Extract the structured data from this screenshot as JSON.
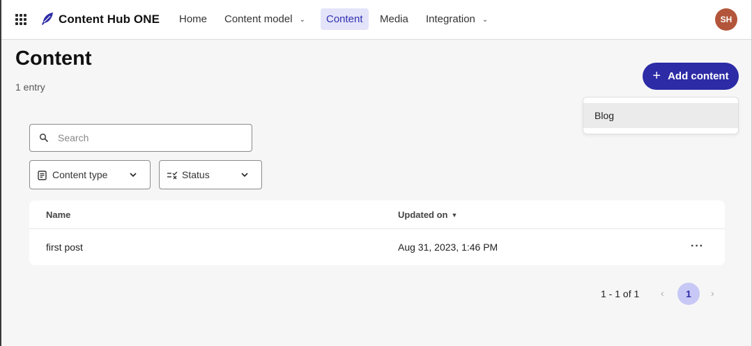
{
  "header": {
    "brand": "Content Hub ONE",
    "nav": [
      {
        "label": "Home",
        "has_dropdown": false,
        "active": false
      },
      {
        "label": "Content model",
        "has_dropdown": true,
        "active": false
      },
      {
        "label": "Content",
        "has_dropdown": false,
        "active": true
      },
      {
        "label": "Media",
        "has_dropdown": false,
        "active": false
      },
      {
        "label": "Integration",
        "has_dropdown": true,
        "active": false
      }
    ],
    "avatar_initials": "SH",
    "icons": [
      "apps-grid-icon",
      "feather-logo-icon"
    ]
  },
  "page": {
    "title": "Content",
    "entry_count": "1 entry"
  },
  "add_content": {
    "label": "Add content",
    "menu_items": [
      "Blog"
    ]
  },
  "search": {
    "placeholder": "Search",
    "value": ""
  },
  "filters": {
    "content_type": "Content type",
    "status": "Status"
  },
  "table": {
    "columns": [
      "Name",
      "Updated on"
    ],
    "rows": [
      {
        "name": "first post",
        "updated_on": "Aug 31, 2023, 1:46 PM"
      }
    ]
  },
  "pagination": {
    "range": "1 - 1 of 1",
    "current_page": "1"
  },
  "colors": {
    "accent": "#2d2ba6",
    "active_nav_bg": "#e3e3fa",
    "avatar_bg": "#b3553a",
    "page_bg": "#f6f6f6"
  }
}
